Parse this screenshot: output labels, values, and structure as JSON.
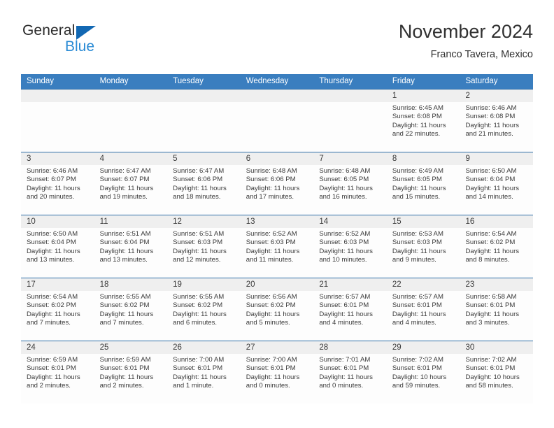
{
  "brand": {
    "name_part1": "General",
    "name_part2": "Blue",
    "triangle_icon": "blue-triangle-icon",
    "accent_color": "#2a8bd5",
    "logo_dark_color": "#2b2b2b"
  },
  "header": {
    "title": "November 2024",
    "subtitle": "Franco Tavera, Mexico"
  },
  "theme": {
    "header_row_bg": "#3a7ebf",
    "header_row_text": "#ffffff",
    "row_divider": "#2f6fa8",
    "day_number_band": "#efefef",
    "cell_bg": "#fdfdfd",
    "body_text": "#3a3a3a"
  },
  "weekdays": [
    "Sunday",
    "Monday",
    "Tuesday",
    "Wednesday",
    "Thursday",
    "Friday",
    "Saturday"
  ],
  "weeks": [
    [
      {
        "day": "",
        "empty": true
      },
      {
        "day": "",
        "empty": true
      },
      {
        "day": "",
        "empty": true
      },
      {
        "day": "",
        "empty": true
      },
      {
        "day": "",
        "empty": true
      },
      {
        "day": "1",
        "sunrise": "Sunrise: 6:45 AM",
        "sunset": "Sunset: 6:08 PM",
        "daylight": "Daylight: 11 hours and 22 minutes."
      },
      {
        "day": "2",
        "sunrise": "Sunrise: 6:46 AM",
        "sunset": "Sunset: 6:08 PM",
        "daylight": "Daylight: 11 hours and 21 minutes."
      }
    ],
    [
      {
        "day": "3",
        "sunrise": "Sunrise: 6:46 AM",
        "sunset": "Sunset: 6:07 PM",
        "daylight": "Daylight: 11 hours and 20 minutes."
      },
      {
        "day": "4",
        "sunrise": "Sunrise: 6:47 AM",
        "sunset": "Sunset: 6:07 PM",
        "daylight": "Daylight: 11 hours and 19 minutes."
      },
      {
        "day": "5",
        "sunrise": "Sunrise: 6:47 AM",
        "sunset": "Sunset: 6:06 PM",
        "daylight": "Daylight: 11 hours and 18 minutes."
      },
      {
        "day": "6",
        "sunrise": "Sunrise: 6:48 AM",
        "sunset": "Sunset: 6:06 PM",
        "daylight": "Daylight: 11 hours and 17 minutes."
      },
      {
        "day": "7",
        "sunrise": "Sunrise: 6:48 AM",
        "sunset": "Sunset: 6:05 PM",
        "daylight": "Daylight: 11 hours and 16 minutes."
      },
      {
        "day": "8",
        "sunrise": "Sunrise: 6:49 AM",
        "sunset": "Sunset: 6:05 PM",
        "daylight": "Daylight: 11 hours and 15 minutes."
      },
      {
        "day": "9",
        "sunrise": "Sunrise: 6:50 AM",
        "sunset": "Sunset: 6:04 PM",
        "daylight": "Daylight: 11 hours and 14 minutes."
      }
    ],
    [
      {
        "day": "10",
        "sunrise": "Sunrise: 6:50 AM",
        "sunset": "Sunset: 6:04 PM",
        "daylight": "Daylight: 11 hours and 13 minutes."
      },
      {
        "day": "11",
        "sunrise": "Sunrise: 6:51 AM",
        "sunset": "Sunset: 6:04 PM",
        "daylight": "Daylight: 11 hours and 13 minutes."
      },
      {
        "day": "12",
        "sunrise": "Sunrise: 6:51 AM",
        "sunset": "Sunset: 6:03 PM",
        "daylight": "Daylight: 11 hours and 12 minutes."
      },
      {
        "day": "13",
        "sunrise": "Sunrise: 6:52 AM",
        "sunset": "Sunset: 6:03 PM",
        "daylight": "Daylight: 11 hours and 11 minutes."
      },
      {
        "day": "14",
        "sunrise": "Sunrise: 6:52 AM",
        "sunset": "Sunset: 6:03 PM",
        "daylight": "Daylight: 11 hours and 10 minutes."
      },
      {
        "day": "15",
        "sunrise": "Sunrise: 6:53 AM",
        "sunset": "Sunset: 6:03 PM",
        "daylight": "Daylight: 11 hours and 9 minutes."
      },
      {
        "day": "16",
        "sunrise": "Sunrise: 6:54 AM",
        "sunset": "Sunset: 6:02 PM",
        "daylight": "Daylight: 11 hours and 8 minutes."
      }
    ],
    [
      {
        "day": "17",
        "sunrise": "Sunrise: 6:54 AM",
        "sunset": "Sunset: 6:02 PM",
        "daylight": "Daylight: 11 hours and 7 minutes."
      },
      {
        "day": "18",
        "sunrise": "Sunrise: 6:55 AM",
        "sunset": "Sunset: 6:02 PM",
        "daylight": "Daylight: 11 hours and 7 minutes."
      },
      {
        "day": "19",
        "sunrise": "Sunrise: 6:55 AM",
        "sunset": "Sunset: 6:02 PM",
        "daylight": "Daylight: 11 hours and 6 minutes."
      },
      {
        "day": "20",
        "sunrise": "Sunrise: 6:56 AM",
        "sunset": "Sunset: 6:02 PM",
        "daylight": "Daylight: 11 hours and 5 minutes."
      },
      {
        "day": "21",
        "sunrise": "Sunrise: 6:57 AM",
        "sunset": "Sunset: 6:01 PM",
        "daylight": "Daylight: 11 hours and 4 minutes."
      },
      {
        "day": "22",
        "sunrise": "Sunrise: 6:57 AM",
        "sunset": "Sunset: 6:01 PM",
        "daylight": "Daylight: 11 hours and 4 minutes."
      },
      {
        "day": "23",
        "sunrise": "Sunrise: 6:58 AM",
        "sunset": "Sunset: 6:01 PM",
        "daylight": "Daylight: 11 hours and 3 minutes."
      }
    ],
    [
      {
        "day": "24",
        "sunrise": "Sunrise: 6:59 AM",
        "sunset": "Sunset: 6:01 PM",
        "daylight": "Daylight: 11 hours and 2 minutes."
      },
      {
        "day": "25",
        "sunrise": "Sunrise: 6:59 AM",
        "sunset": "Sunset: 6:01 PM",
        "daylight": "Daylight: 11 hours and 2 minutes."
      },
      {
        "day": "26",
        "sunrise": "Sunrise: 7:00 AM",
        "sunset": "Sunset: 6:01 PM",
        "daylight": "Daylight: 11 hours and 1 minute."
      },
      {
        "day": "27",
        "sunrise": "Sunrise: 7:00 AM",
        "sunset": "Sunset: 6:01 PM",
        "daylight": "Daylight: 11 hours and 0 minutes."
      },
      {
        "day": "28",
        "sunrise": "Sunrise: 7:01 AM",
        "sunset": "Sunset: 6:01 PM",
        "daylight": "Daylight: 11 hours and 0 minutes."
      },
      {
        "day": "29",
        "sunrise": "Sunrise: 7:02 AM",
        "sunset": "Sunset: 6:01 PM",
        "daylight": "Daylight: 10 hours and 59 minutes."
      },
      {
        "day": "30",
        "sunrise": "Sunrise: 7:02 AM",
        "sunset": "Sunset: 6:01 PM",
        "daylight": "Daylight: 10 hours and 58 minutes."
      }
    ]
  ]
}
